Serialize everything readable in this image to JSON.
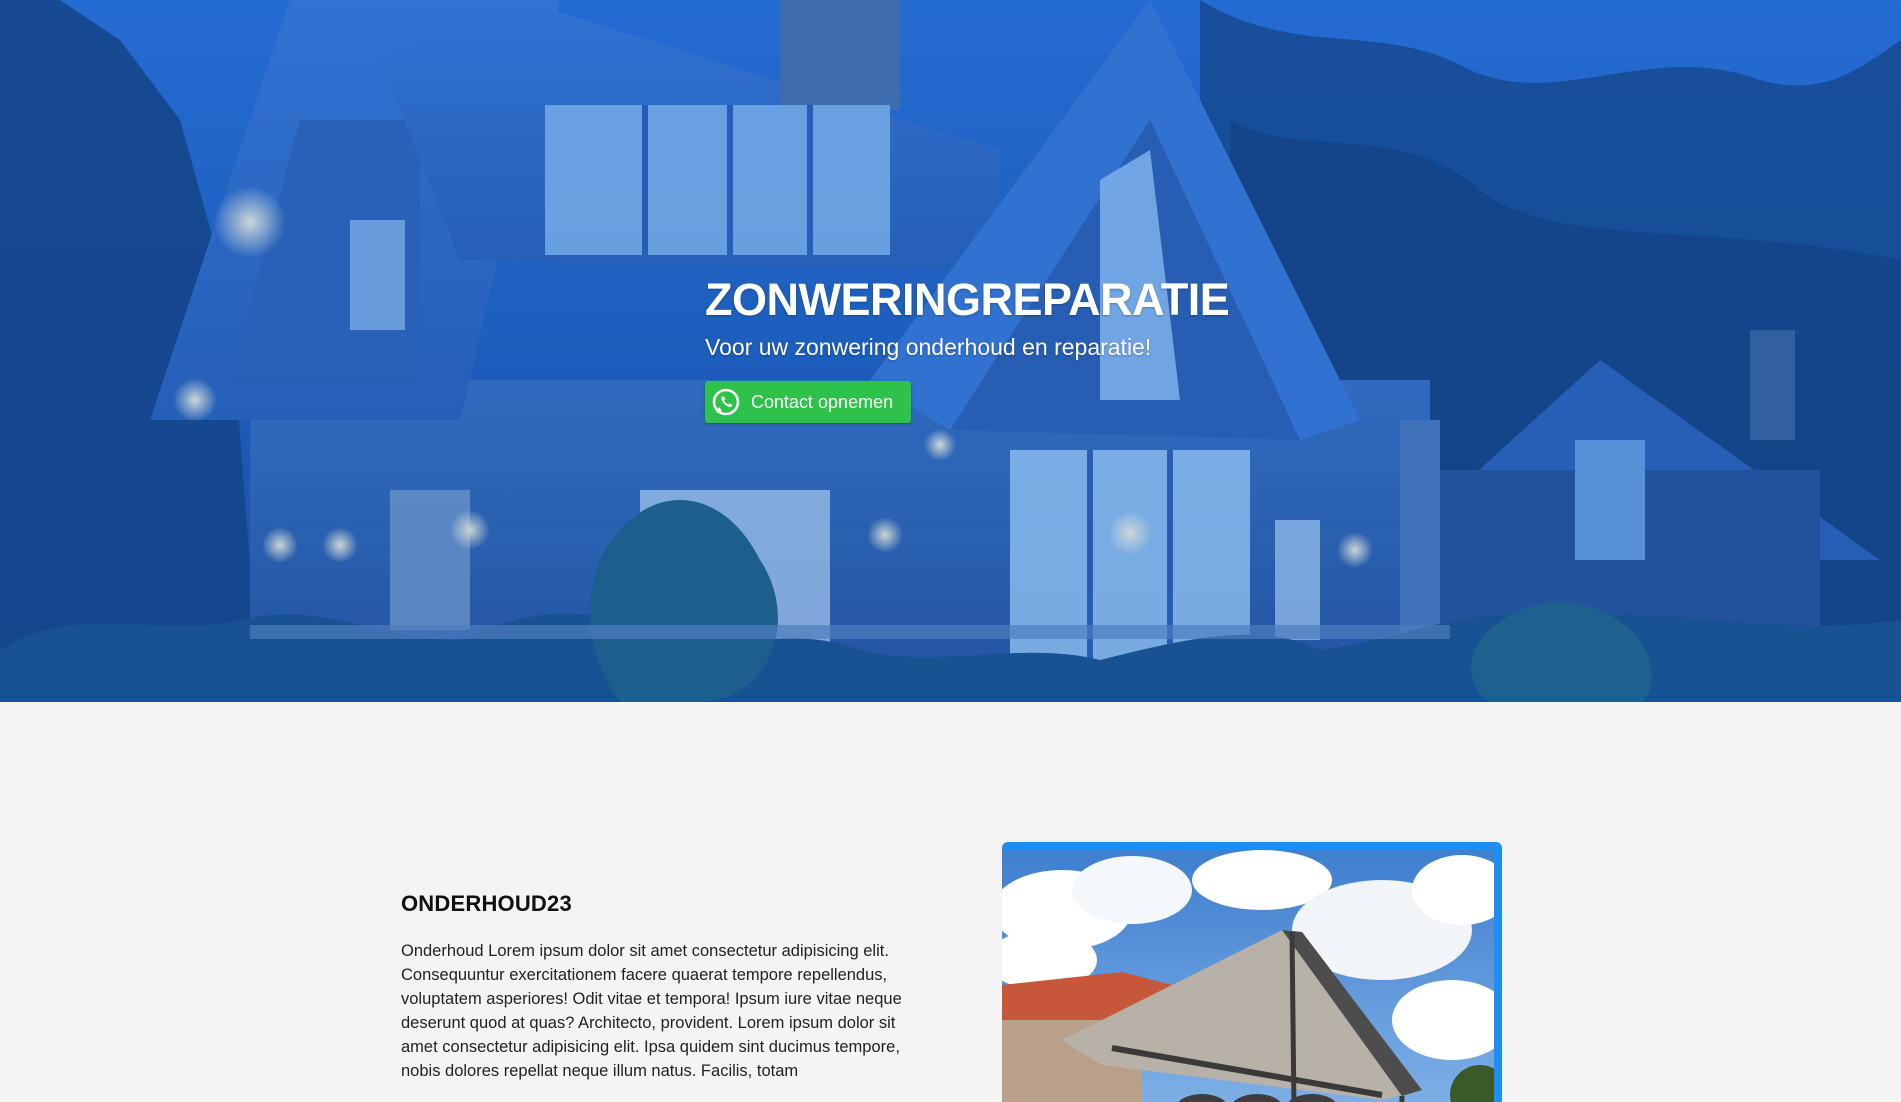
{
  "hero": {
    "title": "ZONWERINGREPARATIE",
    "subtitle": "Voor uw zonwering onderhoud en reparatie!",
    "cta_label": "Contact opnemen",
    "cta_icon": "whatsapp-icon",
    "cta_color": "#2ec24a",
    "overlay_color": "#1e5fd6"
  },
  "section": {
    "heading": "ONDERHOUD23",
    "body": "Onderhoud Lorem ipsum dolor sit amet consectetur adipisicing elit. Consequuntur exercitationem facere quaerat tempore repellendus, voluptatem asperiores! Odit vitae et tempora! Ipsum iure vitae neque deserunt quod at quas? Architecto, provident. Lorem ipsum dolor sit amet consectetur adipisicing elit. Ipsa quidem sint ducimus tempore, nobis dolores repellat neque illum natus. Facilis, totam",
    "image_frame_color": "#1e8ef2"
  }
}
